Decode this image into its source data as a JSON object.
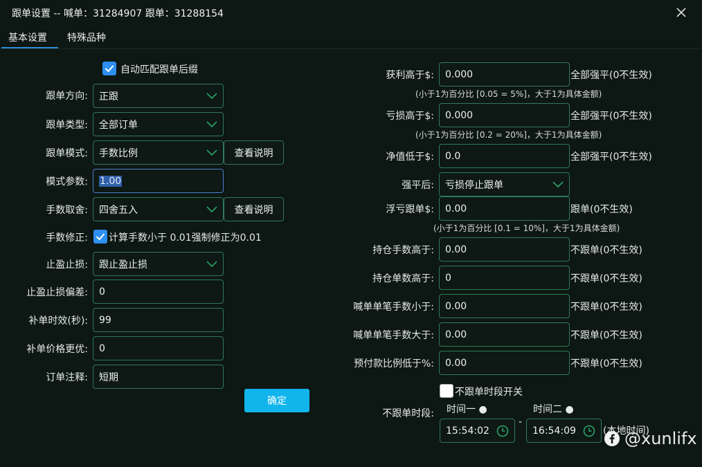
{
  "window": {
    "title": "跟单设置 -- 喊单：31284907 跟单：31288154"
  },
  "tabs": [
    {
      "label": "基本设置"
    },
    {
      "label": "特殊品种"
    }
  ],
  "left": {
    "auto_match": {
      "label": "自动匹配跟单后缀",
      "checked": true
    },
    "direction": {
      "label": "跟单方向:",
      "value": "正跟"
    },
    "type": {
      "label": "跟单类型:",
      "value": "全部订单"
    },
    "mode": {
      "label": "跟单模式:",
      "value": "手数比例",
      "help": "查看说明"
    },
    "mode_param": {
      "label": "模式参数:",
      "value": "1.00"
    },
    "rounding": {
      "label": "手数取舍:",
      "value": "四舍五入",
      "help": "查看说明"
    },
    "lot_fix": {
      "label": "手数修正:",
      "text": "计算手数小于 0.01强制修正为0.01",
      "checked": true
    },
    "sltp": {
      "label": "止盈止损:",
      "value": "跟止盈止损"
    },
    "sltp_offset": {
      "label": "止盈止损偏差:",
      "value": "0"
    },
    "fill_timeout": {
      "label": "补单时效(秒):",
      "value": "99"
    },
    "fill_better": {
      "label": "补单价格更优:",
      "value": "0"
    },
    "comment": {
      "label": "订单注释:",
      "value": "短期"
    },
    "confirm": "确定"
  },
  "right": {
    "profit_above": {
      "label": "获利高于$:",
      "value": "0.000",
      "suffix": "全部强平(0不生效)",
      "hint": "(小于1为百分比 [0.05 = 5%]，大于1为具体金额)"
    },
    "loss_above": {
      "label": "亏损高于$:",
      "value": "0.000",
      "suffix": "全部强平(0不生效)",
      "hint": "(小于1为百分比 [0.2 = 20%]，大于1为具体金额)"
    },
    "equity_below": {
      "label": "净值低于$:",
      "value": "0.0",
      "suffix": "全部强平(0不生效)"
    },
    "after_force": {
      "label": "强平后:",
      "value": "亏损停止跟单"
    },
    "floating_loss": {
      "label": "浮亏跟单$:",
      "value": "0.00",
      "suffix": "跟单(0不生效)",
      "hint": "(小于1为百分比 [0.1 = 10%]，大于1为具体金额)"
    },
    "pos_lots_above": {
      "label": "持仓手数高于:",
      "value": "0.00",
      "suffix": "不跟单(0不生效)"
    },
    "pos_count_above": {
      "label": "持仓单数高于:",
      "value": "0",
      "suffix": "不跟单(0不生效)"
    },
    "signal_lots_below": {
      "label": "喊单单笔手数小于:",
      "value": "0.00",
      "suffix": "不跟单(0不生效)"
    },
    "signal_lots_above": {
      "label": "喊单单笔手数大于:",
      "value": "0.00",
      "suffix": "不跟单(0不生效)"
    },
    "margin_ratio_below": {
      "label": "预付款比例低于%:",
      "value": "0.00",
      "suffix": "不跟单(0不生效)"
    },
    "no_follow_switch": {
      "label": "不跟单时段开关",
      "checked": false
    },
    "no_follow_period": {
      "label": "不跟单时段:",
      "time1_label": "时间一 ●",
      "time2_label": "时间二 ●",
      "time1": "15:54:02",
      "time2": "16:54:09",
      "separator": "-",
      "suffix": "(本地时间)"
    }
  },
  "watermark": {
    "text": "@xunlifx"
  },
  "colors": {
    "background": "#0d1713",
    "border": "#2f7a59",
    "accent": "#11b5ec",
    "checkbox": "#2e8ff0"
  }
}
